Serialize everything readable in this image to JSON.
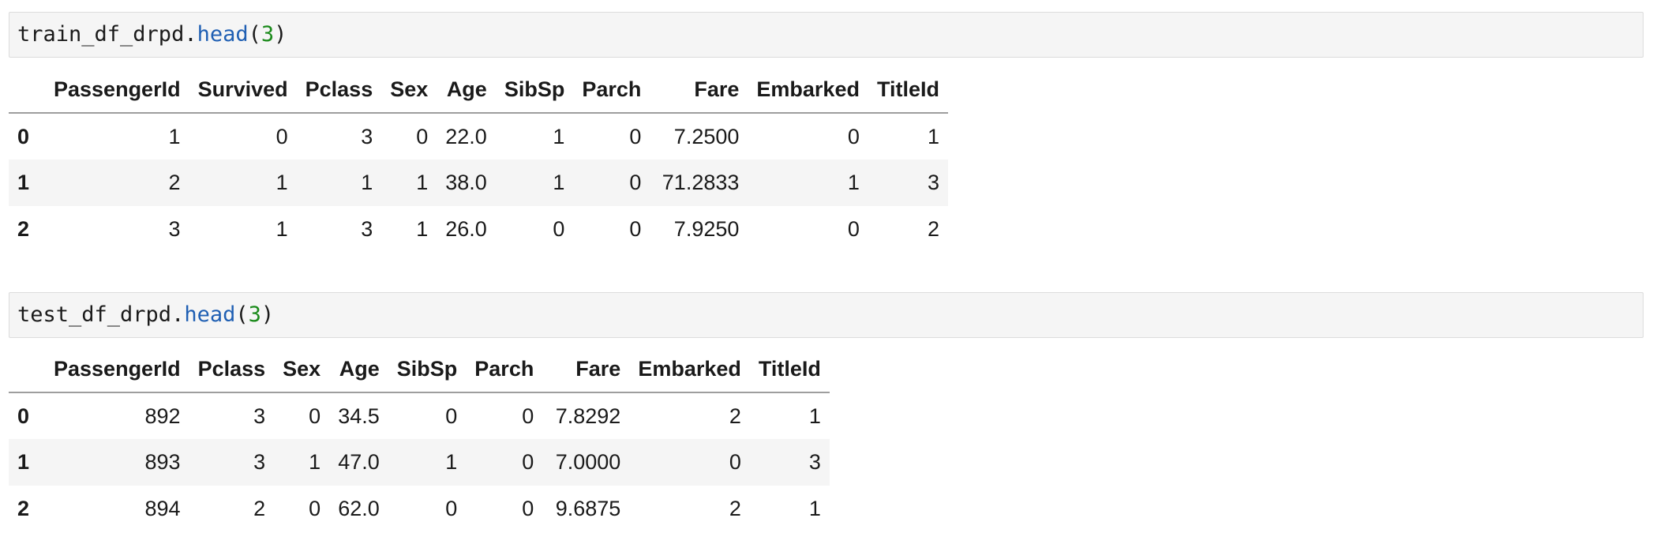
{
  "cells": [
    {
      "code": {
        "object": "train_df_drpd.",
        "method": "head",
        "open": "(",
        "arg": "3",
        "close": ")"
      },
      "table": {
        "columns": [
          "",
          "PassengerId",
          "Survived",
          "Pclass",
          "Sex",
          "Age",
          "SibSp",
          "Parch",
          "Fare",
          "Embarked",
          "TitleId"
        ],
        "rows": [
          [
            "0",
            "1",
            "0",
            "3",
            "0",
            "22.0",
            "1",
            "0",
            "7.2500",
            "0",
            "1"
          ],
          [
            "1",
            "2",
            "1",
            "1",
            "1",
            "38.0",
            "1",
            "0",
            "71.2833",
            "1",
            "3"
          ],
          [
            "2",
            "3",
            "1",
            "3",
            "1",
            "26.0",
            "0",
            "0",
            "7.9250",
            "0",
            "2"
          ]
        ]
      }
    },
    {
      "code": {
        "object": "test_df_drpd.",
        "method": "head",
        "open": "(",
        "arg": "3",
        "close": ")"
      },
      "table": {
        "columns": [
          "",
          "PassengerId",
          "Pclass",
          "Sex",
          "Age",
          "SibSp",
          "Parch",
          "Fare",
          "Embarked",
          "TitleId"
        ],
        "rows": [
          [
            "0",
            "892",
            "3",
            "0",
            "34.5",
            "0",
            "0",
            "7.8292",
            "2",
            "1"
          ],
          [
            "1",
            "893",
            "3",
            "1",
            "47.0",
            "1",
            "0",
            "7.0000",
            "0",
            "3"
          ],
          [
            "2",
            "894",
            "2",
            "0",
            "62.0",
            "0",
            "0",
            "9.6875",
            "2",
            "1"
          ]
        ]
      }
    }
  ],
  "colors": {
    "method": "#1f5fb3",
    "number": "#1a8a1a",
    "code_bg": "#f5f5f5",
    "stripe_bg": "#f5f5f5"
  }
}
